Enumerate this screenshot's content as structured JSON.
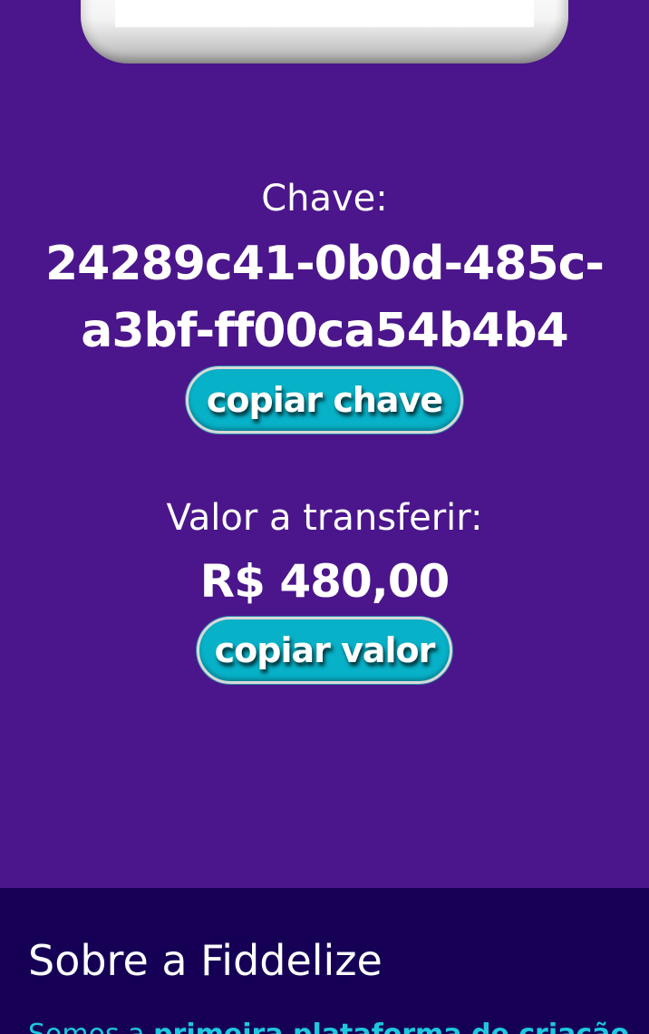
{
  "pix": {
    "chave_label": "Chave:",
    "chave_value": "24289c41-0b0d-485c-a3bf-ff00ca54b4b4",
    "copy_key_button": "copiar chave",
    "valor_label": "Valor a transferir:",
    "valor_value": "R$ 480,00",
    "copy_value_button": "copiar valor"
  },
  "footer": {
    "title": "Sobre a Fiddelize",
    "intro_regular": "Somos a ",
    "intro_bold": "primeira plataforma de criação"
  },
  "colors": {
    "page_background": "#4b168b",
    "footer_background": "#150056",
    "button_background": "#07b1c7",
    "footer_text": "#1ec8e0"
  }
}
